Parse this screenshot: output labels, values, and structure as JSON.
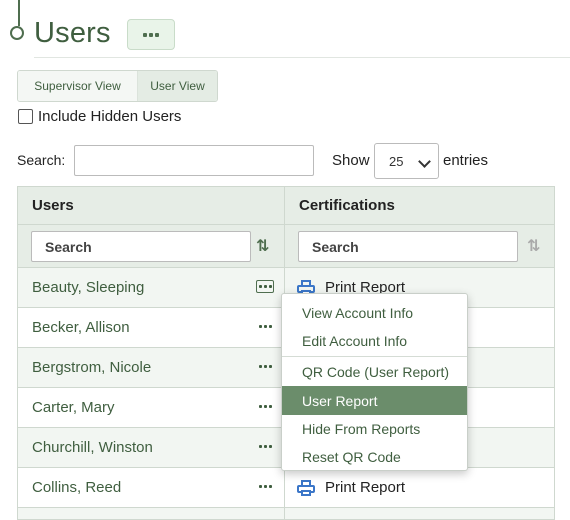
{
  "page": {
    "title": "Users"
  },
  "view_toggle": {
    "supervisor": "Supervisor View",
    "user": "User View"
  },
  "include_hidden": {
    "label": "Include Hidden Users",
    "checked": false
  },
  "search": {
    "label": "Search:",
    "value": ""
  },
  "length": {
    "show": "Show",
    "value": "25",
    "entries": "entries"
  },
  "table": {
    "columns": [
      "Users",
      "Certifications"
    ],
    "filter_placeholders": [
      "Search",
      "Search"
    ],
    "rows": [
      {
        "name": "Beauty, Sleeping",
        "cert": "Print Report"
      },
      {
        "name": "Becker, Allison",
        "cert": ""
      },
      {
        "name": "Bergstrom, Nicole",
        "cert": ""
      },
      {
        "name": "Carter, Mary",
        "cert": ""
      },
      {
        "name": "Churchill, Winston",
        "cert": ""
      },
      {
        "name": "Collins, Reed",
        "cert": "Print Report"
      }
    ]
  },
  "menu": {
    "items": [
      "View Account Info",
      "Edit Account Info",
      "QR Code (User Report)",
      "User Report",
      "Hide From Reports",
      "Reset QR Code"
    ],
    "highlighted": "User Report"
  },
  "colors": {
    "accent": "#4f6e4f",
    "highlight": "#6b8d6b",
    "printer": "#3b76c8"
  },
  "icons": {
    "row_actions": "ellipsis-icon",
    "print": "printer-icon",
    "sort": "sort-icon"
  }
}
